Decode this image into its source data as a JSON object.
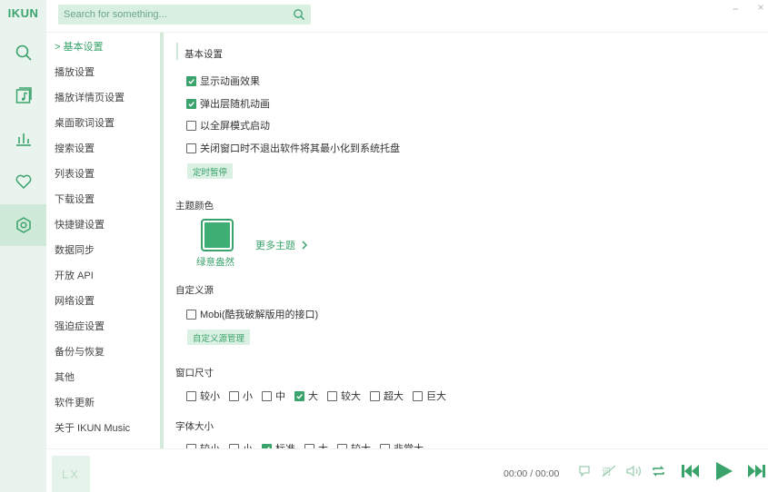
{
  "app": {
    "brand": "IKUN"
  },
  "search": {
    "placeholder": "Search for something..."
  },
  "rail": [
    "search",
    "music-list",
    "chart",
    "favorite",
    "settings"
  ],
  "nav": {
    "items": [
      {
        "label": "> 基本设置",
        "active": true
      },
      {
        "label": "播放设置"
      },
      {
        "label": "播放详情页设置"
      },
      {
        "label": "桌面歌词设置"
      },
      {
        "label": "搜索设置"
      },
      {
        "label": "列表设置"
      },
      {
        "label": "下载设置"
      },
      {
        "label": "快捷键设置"
      },
      {
        "label": "数据同步"
      },
      {
        "label": "开放 API"
      },
      {
        "label": "网络设置"
      },
      {
        "label": "强迫症设置"
      },
      {
        "label": "备份与恢复"
      },
      {
        "label": "其他"
      },
      {
        "label": "软件更新"
      },
      {
        "label": "关于 IKUN Music"
      }
    ]
  },
  "basic": {
    "title": "基本设置",
    "options": [
      {
        "label": "显示动画效果",
        "checked": true
      },
      {
        "label": "弹出层随机动画",
        "checked": true
      },
      {
        "label": "以全屏模式启动",
        "checked": false
      },
      {
        "label": "关闭窗口时不退出软件将其最小化到系统托盘",
        "checked": false
      }
    ],
    "timer_button": "定时暂停"
  },
  "theme": {
    "title": "主题颜色",
    "current": "绿意盎然",
    "more": "更多主题",
    "color": "#3fae75"
  },
  "custom_source": {
    "title": "自定义源",
    "option": {
      "label": "Mobi(酷我破解版用的接口)",
      "checked": false
    },
    "manage_button": "自定义源管理"
  },
  "window_size": {
    "title": "窗口尺寸",
    "options": [
      {
        "label": "较小",
        "checked": false
      },
      {
        "label": "小",
        "checked": false
      },
      {
        "label": "中",
        "checked": false
      },
      {
        "label": "大",
        "checked": true
      },
      {
        "label": "较大",
        "checked": false
      },
      {
        "label": "超大",
        "checked": false
      },
      {
        "label": "巨大",
        "checked": false
      }
    ]
  },
  "font_size": {
    "title": "字体大小",
    "options": [
      {
        "label": "较小",
        "checked": false
      },
      {
        "label": "小",
        "checked": false
      },
      {
        "label": "标准",
        "checked": true
      },
      {
        "label": "大",
        "checked": false
      },
      {
        "label": "较大",
        "checked": false
      },
      {
        "label": "非常大",
        "checked": false
      }
    ]
  },
  "player": {
    "cover_text": "LX",
    "time": "00:00 / 00:00",
    "accent": "#3aa36b"
  }
}
